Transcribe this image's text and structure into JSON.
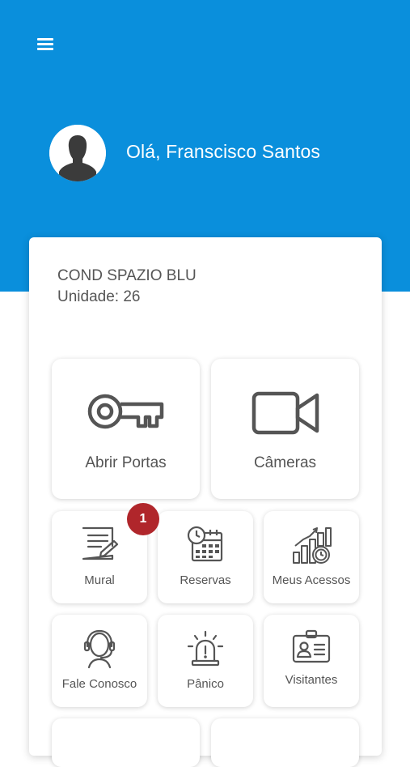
{
  "header": {
    "greeting": "Olá, Franscisco Santos",
    "menu_icon": "hamburger-menu-icon",
    "background_color": "#0a8fdc"
  },
  "condo": {
    "name": "COND SPAZIO BLU",
    "unit": "Unidade: 26"
  },
  "tiles": {
    "abrir_portas": {
      "label": "Abrir Portas",
      "icon": "key-icon"
    },
    "cameras": {
      "label": "Câmeras",
      "icon": "video-camera-icon"
    },
    "mural": {
      "label": "Mural",
      "icon": "notepad-icon",
      "badge": "1"
    },
    "reservas": {
      "label": "Reservas",
      "icon": "calendar-clock-icon"
    },
    "meus_acessos": {
      "label": "Meus Acessos",
      "icon": "growth-chart-icon"
    },
    "fale_conosco": {
      "label": "Fale Conosco",
      "icon": "headset-icon"
    },
    "panico": {
      "label": "Pânico",
      "icon": "alarm-siren-icon"
    },
    "visitantes": {
      "label": "Visitantes",
      "icon": "id-badge-icon"
    }
  },
  "colors": {
    "badge": "#b0262b",
    "icon_stroke": "#555555"
  }
}
